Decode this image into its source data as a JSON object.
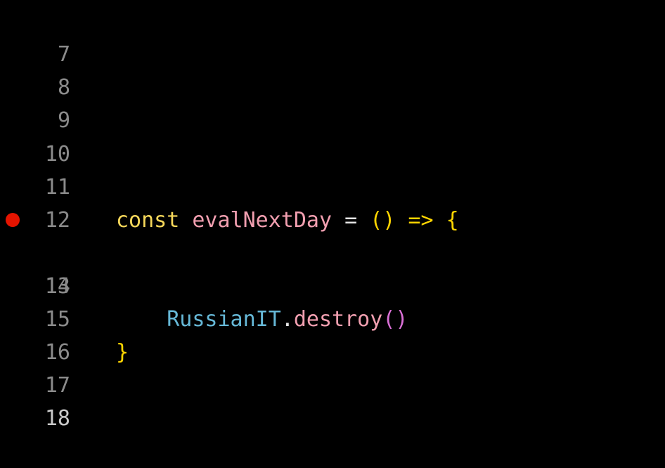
{
  "editor": {
    "lines": [
      {
        "number": "7"
      },
      {
        "number": "8"
      },
      {
        "number": "9"
      },
      {
        "number": "10"
      },
      {
        "number": "11",
        "tokens": {
          "keyword": "const",
          "fn": "evalNextDay",
          "eq": "=",
          "parens": "()",
          "arrow": "=>",
          "brace_open": "{"
        }
      },
      {
        "number": "12"
      },
      {
        "number": "13",
        "breakpoint": true,
        "tokens": {
          "object": "RussianIT",
          "dot": ".",
          "method": "destroy",
          "call": "()"
        }
      },
      {
        "number": "14"
      },
      {
        "number": "15",
        "tokens": {
          "brace_close": "}"
        }
      },
      {
        "number": "16"
      },
      {
        "number": "17"
      },
      {
        "number": "18",
        "active": true
      }
    ]
  },
  "colors": {
    "background": "#000000",
    "line_number": "#8b8b8b",
    "line_number_active": "#c8c8c8",
    "breakpoint": "#e51400",
    "keyword": "#f5d75a",
    "identifier": "#f29fb0",
    "brace": "#ffd500",
    "object": "#66b8d7",
    "nested_paren": "#da70d6"
  }
}
